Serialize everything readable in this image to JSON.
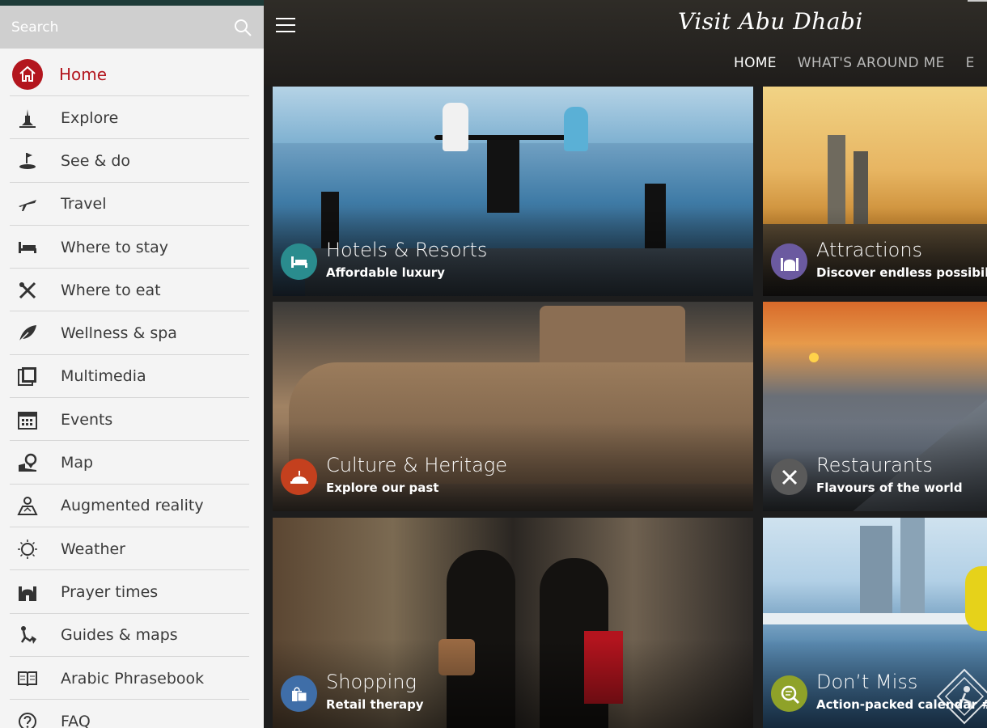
{
  "search": {
    "placeholder": "Search"
  },
  "menu": {
    "items": [
      {
        "label": "Home",
        "icon": "home-icon"
      },
      {
        "label": "Explore",
        "icon": "explore-icon"
      },
      {
        "label": "See & do",
        "icon": "see-do-icon"
      },
      {
        "label": "Travel",
        "icon": "plane-icon"
      },
      {
        "label": "Where to stay",
        "icon": "bed-icon"
      },
      {
        "label": "Where to eat",
        "icon": "cutlery-icon"
      },
      {
        "label": "Wellness & spa",
        "icon": "leaf-icon"
      },
      {
        "label": "Multimedia",
        "icon": "multimedia-icon"
      },
      {
        "label": "Events",
        "icon": "calendar-icon"
      },
      {
        "label": "Map",
        "icon": "map-pin-icon"
      },
      {
        "label": "Augmented reality",
        "icon": "augmented-reality-icon"
      },
      {
        "label": "Weather",
        "icon": "sun-icon"
      },
      {
        "label": "Prayer times",
        "icon": "mosque-icon"
      },
      {
        "label": "Guides & maps",
        "icon": "guides-icon"
      },
      {
        "label": "Arabic Phrasebook",
        "icon": "book-icon"
      },
      {
        "label": "FAQ",
        "icon": "question-icon"
      }
    ]
  },
  "header": {
    "logo": "Visit Abu Dhabi",
    "tabs": [
      "HOME",
      "WHAT'S AROUND ME",
      "E"
    ],
    "active_tab": "HOME"
  },
  "tiles": [
    {
      "title": "Hotels & Resorts",
      "subtitle": "Affordable luxury",
      "icon": "bed-icon",
      "icon_color": "#2a8c8e"
    },
    {
      "title": "Attractions",
      "subtitle": "Discover endless possibilities",
      "icon": "mosque-icon",
      "icon_color": "#6b5aa0"
    },
    {
      "title": "Culture & Heritage",
      "subtitle": "Explore our past",
      "icon": "dome-icon",
      "icon_color": "#c4401e"
    },
    {
      "title": "Restaurants",
      "subtitle": "Flavours of the world",
      "icon": "cutlery-icon",
      "icon_color": "#5a5a5a"
    },
    {
      "title": "Shopping",
      "subtitle": "Retail therapy",
      "icon": "shopping-bag-icon",
      "icon_color": "#3f6ea8"
    },
    {
      "title": "Don’t Miss",
      "subtitle": "Action-packed calendar #InA",
      "icon": "search-list-icon",
      "icon_color": "#8fa229"
    }
  ],
  "colors": {
    "accent": "#b3161e",
    "sidebar_bg": "#f4f4f4",
    "search_bg": "#cfcfcf"
  }
}
